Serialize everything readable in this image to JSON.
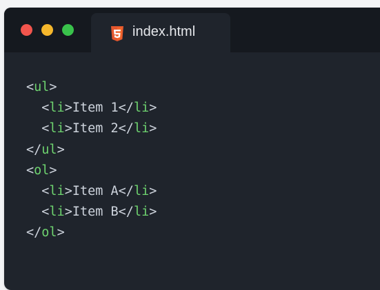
{
  "window": {
    "traffic_lights": {
      "close_color": "#f2554d",
      "minimize_color": "#f5b72c",
      "maximize_color": "#39c24b"
    }
  },
  "tab": {
    "icon": "html5-icon",
    "icon_color": "#e4572e",
    "label": "index.html"
  },
  "code": {
    "lines": [
      {
        "indent": "",
        "open": "<",
        "tag": "ul",
        "close": ">",
        "text": "",
        "end_open": "",
        "end_tag": "",
        "end_close": ""
      },
      {
        "indent": "  ",
        "open": "<",
        "tag": "li",
        "close": ">",
        "text": "Item 1",
        "end_open": "</",
        "end_tag": "li",
        "end_close": ">"
      },
      {
        "indent": "  ",
        "open": "<",
        "tag": "li",
        "close": ">",
        "text": "Item 2",
        "end_open": "</",
        "end_tag": "li",
        "end_close": ">"
      },
      {
        "indent": "",
        "open": "</",
        "tag": "ul",
        "close": ">",
        "text": "",
        "end_open": "",
        "end_tag": "",
        "end_close": ""
      },
      {
        "indent": "",
        "open": "<",
        "tag": "ol",
        "close": ">",
        "text": "",
        "end_open": "",
        "end_tag": "",
        "end_close": ""
      },
      {
        "indent": "  ",
        "open": "<",
        "tag": "li",
        "close": ">",
        "text": "Item A",
        "end_open": "</",
        "end_tag": "li",
        "end_close": ">"
      },
      {
        "indent": "  ",
        "open": "<",
        "tag": "li",
        "close": ">",
        "text": "Item B",
        "end_open": "</",
        "end_tag": "li",
        "end_close": ">"
      },
      {
        "indent": "",
        "open": "</",
        "tag": "ol",
        "close": ">",
        "text": "",
        "end_open": "",
        "end_tag": "",
        "end_close": ""
      }
    ]
  }
}
